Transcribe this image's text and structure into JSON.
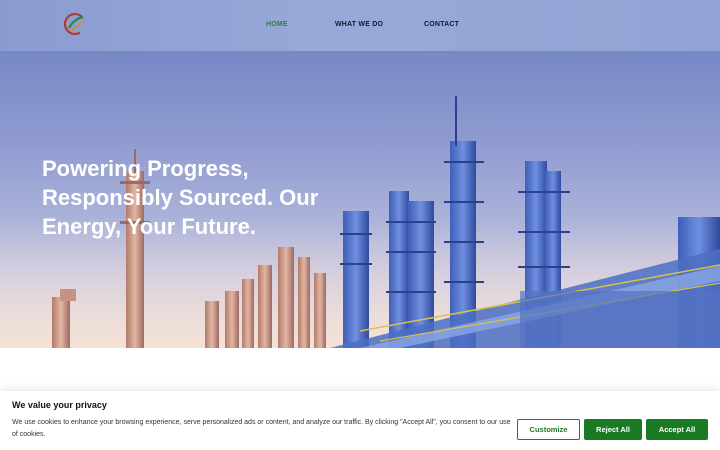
{
  "nav": {
    "home": "HOME",
    "what_we_do": "WHAT WE DO",
    "contact": "CONTACT",
    "active_color": "#1d8a2c"
  },
  "hero": {
    "title": "Powering Progress, Responsibly Sourced. Our Energy, Your Future."
  },
  "cookie": {
    "title": "We value your privacy",
    "text": "We use cookies to enhance your browsing experience, serve personalized ads or content, and analyze our traffic. By clicking \"Accept All\", you consent to our use of cookies.",
    "customize": "Customize",
    "reject": "Reject All",
    "accept": "Accept All",
    "button_color": "#1a7a24"
  }
}
